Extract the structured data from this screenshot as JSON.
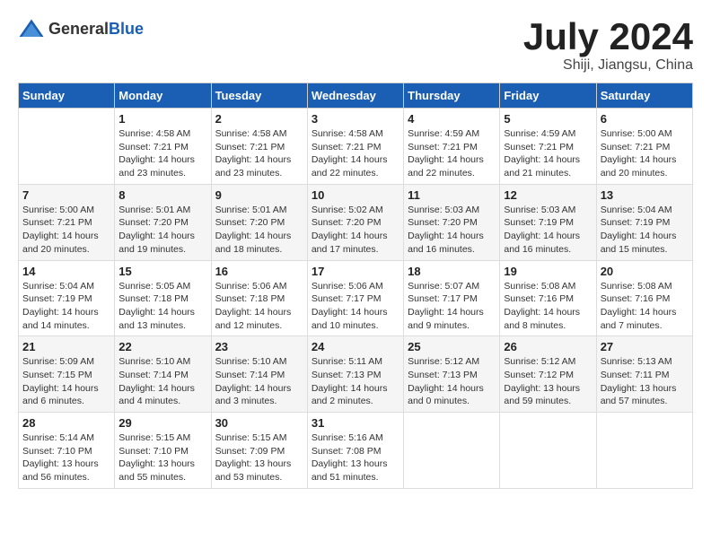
{
  "header": {
    "logo_general": "General",
    "logo_blue": "Blue",
    "month_title": "July 2024",
    "subtitle": "Shiji, Jiangsu, China"
  },
  "days_of_week": [
    "Sunday",
    "Monday",
    "Tuesday",
    "Wednesday",
    "Thursday",
    "Friday",
    "Saturday"
  ],
  "weeks": [
    [
      {
        "day": "",
        "sunrise": "",
        "sunset": "",
        "daylight": ""
      },
      {
        "day": "1",
        "sunrise": "Sunrise: 4:58 AM",
        "sunset": "Sunset: 7:21 PM",
        "daylight": "Daylight: 14 hours and 23 minutes."
      },
      {
        "day": "2",
        "sunrise": "Sunrise: 4:58 AM",
        "sunset": "Sunset: 7:21 PM",
        "daylight": "Daylight: 14 hours and 23 minutes."
      },
      {
        "day": "3",
        "sunrise": "Sunrise: 4:58 AM",
        "sunset": "Sunset: 7:21 PM",
        "daylight": "Daylight: 14 hours and 22 minutes."
      },
      {
        "day": "4",
        "sunrise": "Sunrise: 4:59 AM",
        "sunset": "Sunset: 7:21 PM",
        "daylight": "Daylight: 14 hours and 22 minutes."
      },
      {
        "day": "5",
        "sunrise": "Sunrise: 4:59 AM",
        "sunset": "Sunset: 7:21 PM",
        "daylight": "Daylight: 14 hours and 21 minutes."
      },
      {
        "day": "6",
        "sunrise": "Sunrise: 5:00 AM",
        "sunset": "Sunset: 7:21 PM",
        "daylight": "Daylight: 14 hours and 20 minutes."
      }
    ],
    [
      {
        "day": "7",
        "sunrise": "Sunrise: 5:00 AM",
        "sunset": "Sunset: 7:21 PM",
        "daylight": "Daylight: 14 hours and 20 minutes."
      },
      {
        "day": "8",
        "sunrise": "Sunrise: 5:01 AM",
        "sunset": "Sunset: 7:20 PM",
        "daylight": "Daylight: 14 hours and 19 minutes."
      },
      {
        "day": "9",
        "sunrise": "Sunrise: 5:01 AM",
        "sunset": "Sunset: 7:20 PM",
        "daylight": "Daylight: 14 hours and 18 minutes."
      },
      {
        "day": "10",
        "sunrise": "Sunrise: 5:02 AM",
        "sunset": "Sunset: 7:20 PM",
        "daylight": "Daylight: 14 hours and 17 minutes."
      },
      {
        "day": "11",
        "sunrise": "Sunrise: 5:03 AM",
        "sunset": "Sunset: 7:20 PM",
        "daylight": "Daylight: 14 hours and 16 minutes."
      },
      {
        "day": "12",
        "sunrise": "Sunrise: 5:03 AM",
        "sunset": "Sunset: 7:19 PM",
        "daylight": "Daylight: 14 hours and 16 minutes."
      },
      {
        "day": "13",
        "sunrise": "Sunrise: 5:04 AM",
        "sunset": "Sunset: 7:19 PM",
        "daylight": "Daylight: 14 hours and 15 minutes."
      }
    ],
    [
      {
        "day": "14",
        "sunrise": "Sunrise: 5:04 AM",
        "sunset": "Sunset: 7:19 PM",
        "daylight": "Daylight: 14 hours and 14 minutes."
      },
      {
        "day": "15",
        "sunrise": "Sunrise: 5:05 AM",
        "sunset": "Sunset: 7:18 PM",
        "daylight": "Daylight: 14 hours and 13 minutes."
      },
      {
        "day": "16",
        "sunrise": "Sunrise: 5:06 AM",
        "sunset": "Sunset: 7:18 PM",
        "daylight": "Daylight: 14 hours and 12 minutes."
      },
      {
        "day": "17",
        "sunrise": "Sunrise: 5:06 AM",
        "sunset": "Sunset: 7:17 PM",
        "daylight": "Daylight: 14 hours and 10 minutes."
      },
      {
        "day": "18",
        "sunrise": "Sunrise: 5:07 AM",
        "sunset": "Sunset: 7:17 PM",
        "daylight": "Daylight: 14 hours and 9 minutes."
      },
      {
        "day": "19",
        "sunrise": "Sunrise: 5:08 AM",
        "sunset": "Sunset: 7:16 PM",
        "daylight": "Daylight: 14 hours and 8 minutes."
      },
      {
        "day": "20",
        "sunrise": "Sunrise: 5:08 AM",
        "sunset": "Sunset: 7:16 PM",
        "daylight": "Daylight: 14 hours and 7 minutes."
      }
    ],
    [
      {
        "day": "21",
        "sunrise": "Sunrise: 5:09 AM",
        "sunset": "Sunset: 7:15 PM",
        "daylight": "Daylight: 14 hours and 6 minutes."
      },
      {
        "day": "22",
        "sunrise": "Sunrise: 5:10 AM",
        "sunset": "Sunset: 7:14 PM",
        "daylight": "Daylight: 14 hours and 4 minutes."
      },
      {
        "day": "23",
        "sunrise": "Sunrise: 5:10 AM",
        "sunset": "Sunset: 7:14 PM",
        "daylight": "Daylight: 14 hours and 3 minutes."
      },
      {
        "day": "24",
        "sunrise": "Sunrise: 5:11 AM",
        "sunset": "Sunset: 7:13 PM",
        "daylight": "Daylight: 14 hours and 2 minutes."
      },
      {
        "day": "25",
        "sunrise": "Sunrise: 5:12 AM",
        "sunset": "Sunset: 7:13 PM",
        "daylight": "Daylight: 14 hours and 0 minutes."
      },
      {
        "day": "26",
        "sunrise": "Sunrise: 5:12 AM",
        "sunset": "Sunset: 7:12 PM",
        "daylight": "Daylight: 13 hours and 59 minutes."
      },
      {
        "day": "27",
        "sunrise": "Sunrise: 5:13 AM",
        "sunset": "Sunset: 7:11 PM",
        "daylight": "Daylight: 13 hours and 57 minutes."
      }
    ],
    [
      {
        "day": "28",
        "sunrise": "Sunrise: 5:14 AM",
        "sunset": "Sunset: 7:10 PM",
        "daylight": "Daylight: 13 hours and 56 minutes."
      },
      {
        "day": "29",
        "sunrise": "Sunrise: 5:15 AM",
        "sunset": "Sunset: 7:10 PM",
        "daylight": "Daylight: 13 hours and 55 minutes."
      },
      {
        "day": "30",
        "sunrise": "Sunrise: 5:15 AM",
        "sunset": "Sunset: 7:09 PM",
        "daylight": "Daylight: 13 hours and 53 minutes."
      },
      {
        "day": "31",
        "sunrise": "Sunrise: 5:16 AM",
        "sunset": "Sunset: 7:08 PM",
        "daylight": "Daylight: 13 hours and 51 minutes."
      },
      {
        "day": "",
        "sunrise": "",
        "sunset": "",
        "daylight": ""
      },
      {
        "day": "",
        "sunrise": "",
        "sunset": "",
        "daylight": ""
      },
      {
        "day": "",
        "sunrise": "",
        "sunset": "",
        "daylight": ""
      }
    ]
  ]
}
